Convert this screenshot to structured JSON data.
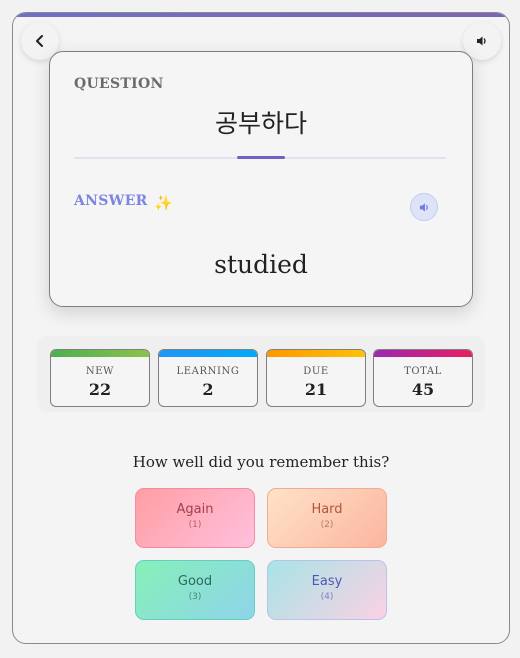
{
  "header": {
    "back_icon": "chevron-left-icon",
    "audio_icon": "speaker-icon"
  },
  "card": {
    "question_label": "QUESTION",
    "question_text": "공부하다",
    "answer_label": "ANSWER",
    "answer_icon": "sparkle-icon",
    "answer_sparkle": "✨",
    "answer_audio_icon": "speaker-icon",
    "answer_text": "studied"
  },
  "stats": [
    {
      "label": "NEW",
      "value": "22",
      "color_from": "#4caf50",
      "color_to": "#8bc34a"
    },
    {
      "label": "LEARNING",
      "value": "2",
      "color_from": "#2196f3",
      "color_to": "#03a9f4"
    },
    {
      "label": "DUE",
      "value": "21",
      "color_from": "#ff9800",
      "color_to": "#ffc107"
    },
    {
      "label": "TOTAL",
      "value": "45",
      "color_from": "#9c27b0",
      "color_to": "#e91e63"
    }
  ],
  "rating": {
    "prompt": "How well did you remember this?",
    "buttons": [
      {
        "label": "Again",
        "key": "(1)"
      },
      {
        "label": "Hard",
        "key": "(2)"
      },
      {
        "label": "Good",
        "key": "(3)"
      },
      {
        "label": "Easy",
        "key": "(4)"
      }
    ]
  },
  "colors": {
    "accent": "#6e62c4",
    "answer_label": "#7a86e0"
  }
}
